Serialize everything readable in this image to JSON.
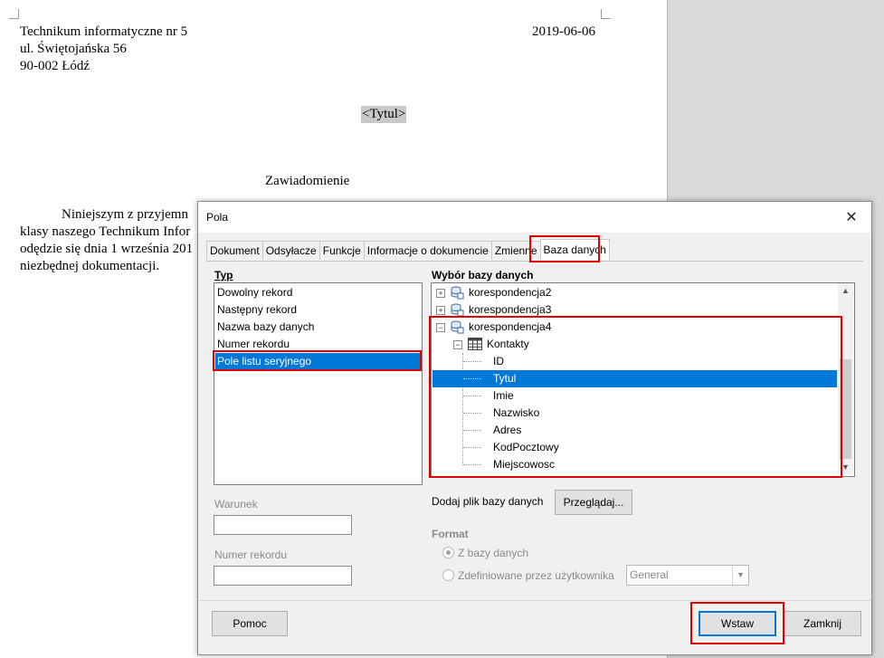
{
  "document": {
    "address_lines": [
      "Technikum informatyczne nr 5",
      "ul. Świętojańska 56",
      "90-002 Łódź"
    ],
    "date": "2019-06-06",
    "placeholder_field": "<Tytul>",
    "heading": "Zawiadomienie",
    "body_lines": [
      "Niniejszym z przyjemn",
      "klasy naszego Technikum Infor",
      "odędzie się dnia 1 września 201",
      "niezbędnej dokumentacji."
    ]
  },
  "dialog": {
    "title": "Pola",
    "close_label": "✕",
    "tabs": [
      "Dokument",
      "Odsyłacze",
      "Funkcje",
      "Informacje o dokumencie",
      "Zmienne",
      "Baza danych"
    ],
    "active_tab": "Baza danych",
    "type_section": {
      "label": "Typ",
      "items": [
        "Dowolny rekord",
        "Następny rekord",
        "Nazwa bazy danych",
        "Numer rekordu",
        "Pole listu seryjnego"
      ],
      "selected": "Pole listu seryjnego"
    },
    "condition_label": "Warunek",
    "record_number_label": "Numer rekordu",
    "database_section": {
      "label": "Wybór bazy danych",
      "tree": {
        "databases": [
          "korespondencja2",
          "korespondencja3",
          "korespondencja4"
        ],
        "table": "Kontakty",
        "fields": [
          "ID",
          "Tytul",
          "Imie",
          "Nazwisko",
          "Adres",
          "KodPocztowy",
          "Miejscowosc"
        ],
        "selected": "Tytul"
      }
    },
    "add_db_label": "Dodaj plik bazy danych",
    "browse_button": "Przeglądaj...",
    "format": {
      "label": "Format",
      "option_from_db": "Z bazy danych",
      "option_user_defined": "Zdefiniowane przez użytkownika",
      "select_value": "General"
    },
    "buttons": {
      "help": "Pomoc",
      "insert": "Wstaw",
      "close": "Zamknij"
    }
  },
  "colors": {
    "selection": "#0078d7",
    "highlight_frame": "#e00000",
    "dialog_bg": "#f0f0f0"
  }
}
